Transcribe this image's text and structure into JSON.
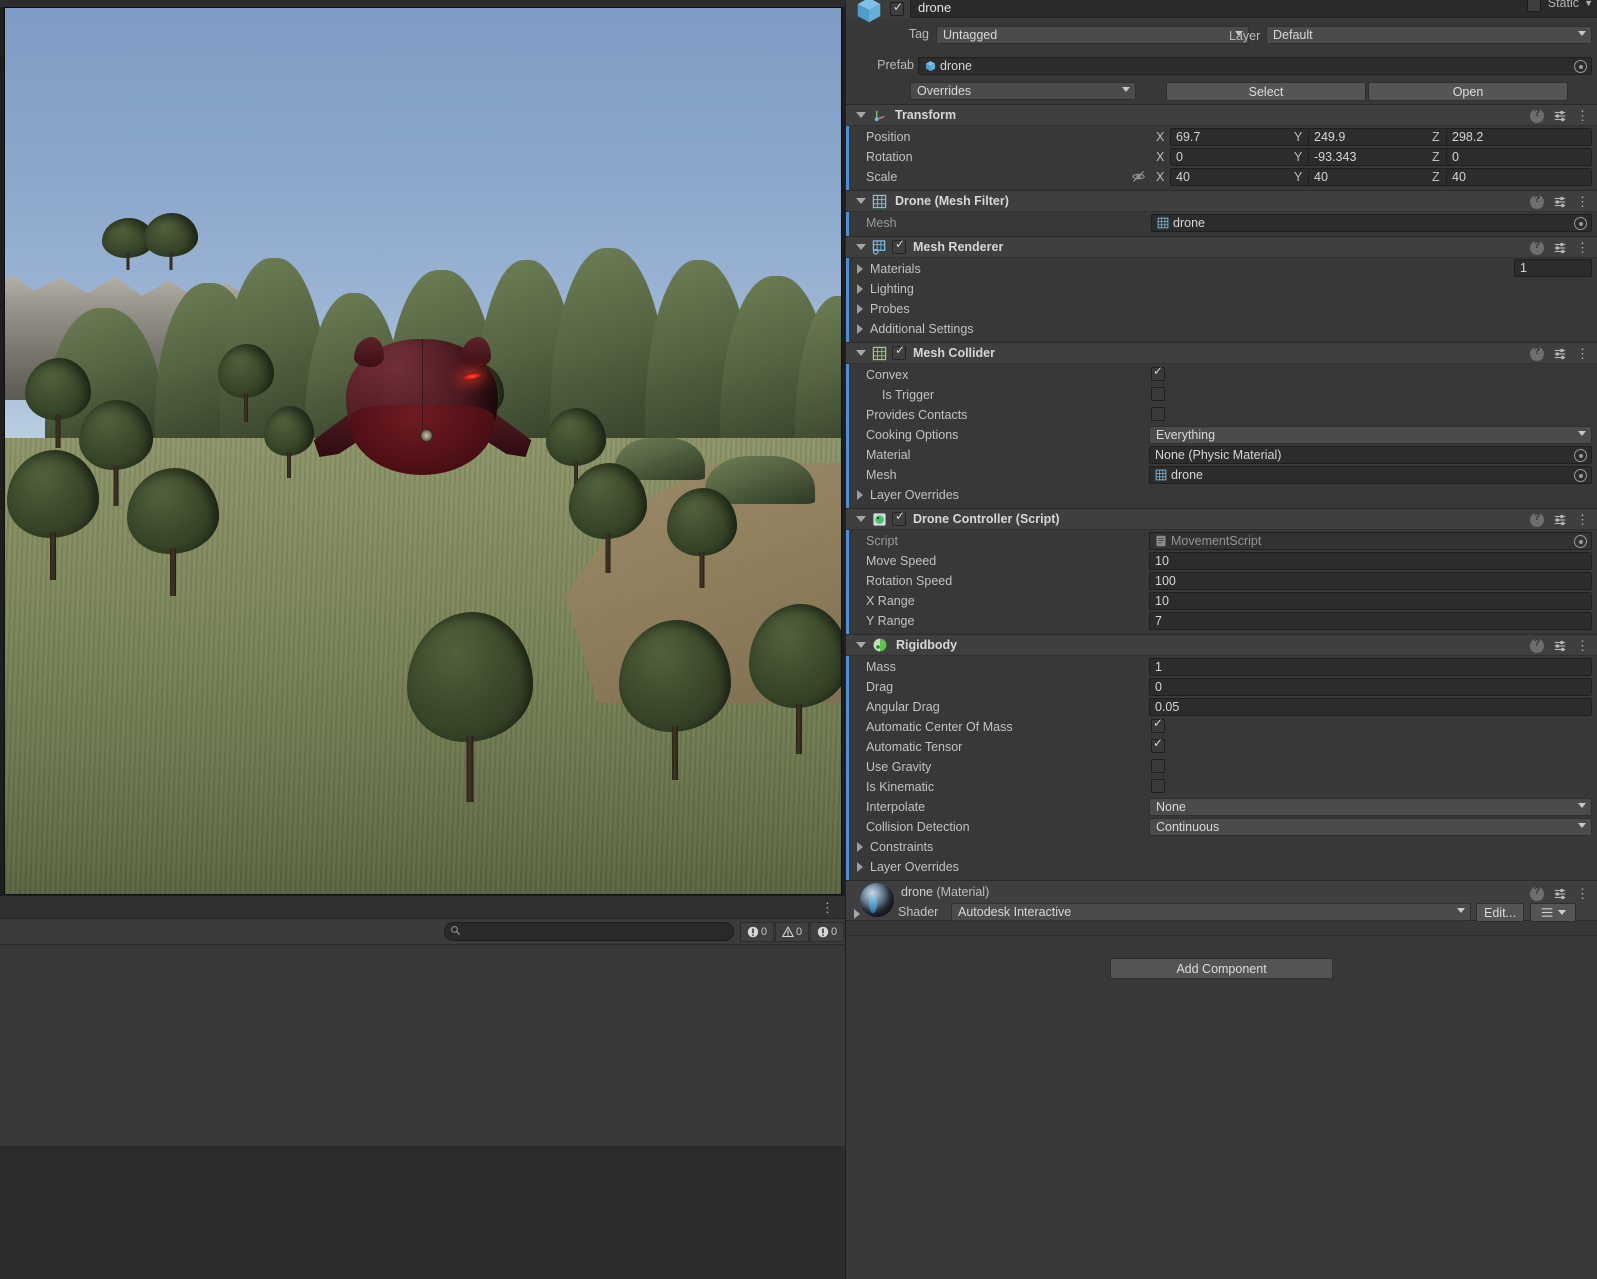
{
  "scene": {
    "name": "scene-view",
    "console": {
      "search_placeholder": "",
      "error_count": "0",
      "warning_count": "0",
      "info_count": "0"
    }
  },
  "inspector": {
    "object": {
      "name": "drone",
      "enabled": true,
      "static_label": "Static",
      "tag_label": "Tag",
      "tag_value": "Untagged",
      "layer_label": "Layer",
      "layer_value": "Default",
      "prefab_label": "Prefab",
      "prefab_value": "drone",
      "overrides_label": "Overrides",
      "select_label": "Select",
      "open_label": "Open"
    },
    "components": [
      {
        "title": "Transform",
        "rows": [
          {
            "label": "Position",
            "x": "69.7",
            "y": "249.9",
            "z": "298.2"
          },
          {
            "label": "Rotation",
            "x": "0",
            "y": "-93.343",
            "z": "0"
          },
          {
            "label": "Scale",
            "x": "40",
            "y": "40",
            "z": "40"
          }
        ],
        "axis_x": "X",
        "axis_y": "Y",
        "axis_z": "Z"
      },
      {
        "title": "Drone (Mesh Filter)",
        "mesh_label": "Mesh",
        "mesh_value": "drone"
      },
      {
        "title": "Mesh Renderer",
        "materials_label": "Materials",
        "materials_count": "1",
        "lighting_label": "Lighting",
        "probes_label": "Probes",
        "additional_label": "Additional Settings"
      },
      {
        "title": "Mesh Collider",
        "convex_label": "Convex",
        "convex_value": true,
        "is_trigger_label": "Is Trigger",
        "is_trigger_value": false,
        "provides_contacts_label": "Provides Contacts",
        "provides_contacts_value": false,
        "cooking_label": "Cooking Options",
        "cooking_value": "Everything",
        "material_label": "Material",
        "material_value": "None (Physic Material)",
        "mesh_label": "Mesh",
        "mesh_value": "drone",
        "layer_overrides_label": "Layer Overrides"
      },
      {
        "title": "Drone Controller (Script)",
        "script_label": "Script",
        "script_value": "MovementScript",
        "move_speed_label": "Move Speed",
        "move_speed_value": "10",
        "rotation_speed_label": "Rotation Speed",
        "rotation_speed_value": "100",
        "x_range_label": "X Range",
        "x_range_value": "10",
        "y_range_label": "Y Range",
        "y_range_value": "7"
      },
      {
        "title": "Rigidbody",
        "mass_label": "Mass",
        "mass_value": "1",
        "drag_label": "Drag",
        "drag_value": "0",
        "angular_drag_label": "Angular Drag",
        "angular_drag_value": "0.05",
        "auto_com_label": "Automatic Center Of Mass",
        "auto_com_value": true,
        "auto_tensor_label": "Automatic Tensor",
        "auto_tensor_value": true,
        "use_gravity_label": "Use Gravity",
        "use_gravity_value": false,
        "is_kinematic_label": "Is Kinematic",
        "is_kinematic_value": false,
        "interpolate_label": "Interpolate",
        "interpolate_value": "None",
        "collision_detection_label": "Collision Detection",
        "collision_detection_value": "Continuous",
        "constraints_label": "Constraints",
        "layer_overrides_label": "Layer Overrides"
      }
    ],
    "material": {
      "name": "drone",
      "suffix": "(Material)",
      "shader_label": "Shader",
      "shader_value": "Autodesk Interactive",
      "edit_label": "Edit..."
    },
    "add_component_label": "Add Component"
  },
  "colors": {
    "accent_blue": "#4d8fd6",
    "panel_bg": "#383838",
    "header_bg": "#3f3f3f",
    "field_bg": "#2c2c2c",
    "dropdown_bg": "#4b4b4b",
    "drone_red": "#5b2129",
    "eye_glow": "#ff4a3c"
  }
}
